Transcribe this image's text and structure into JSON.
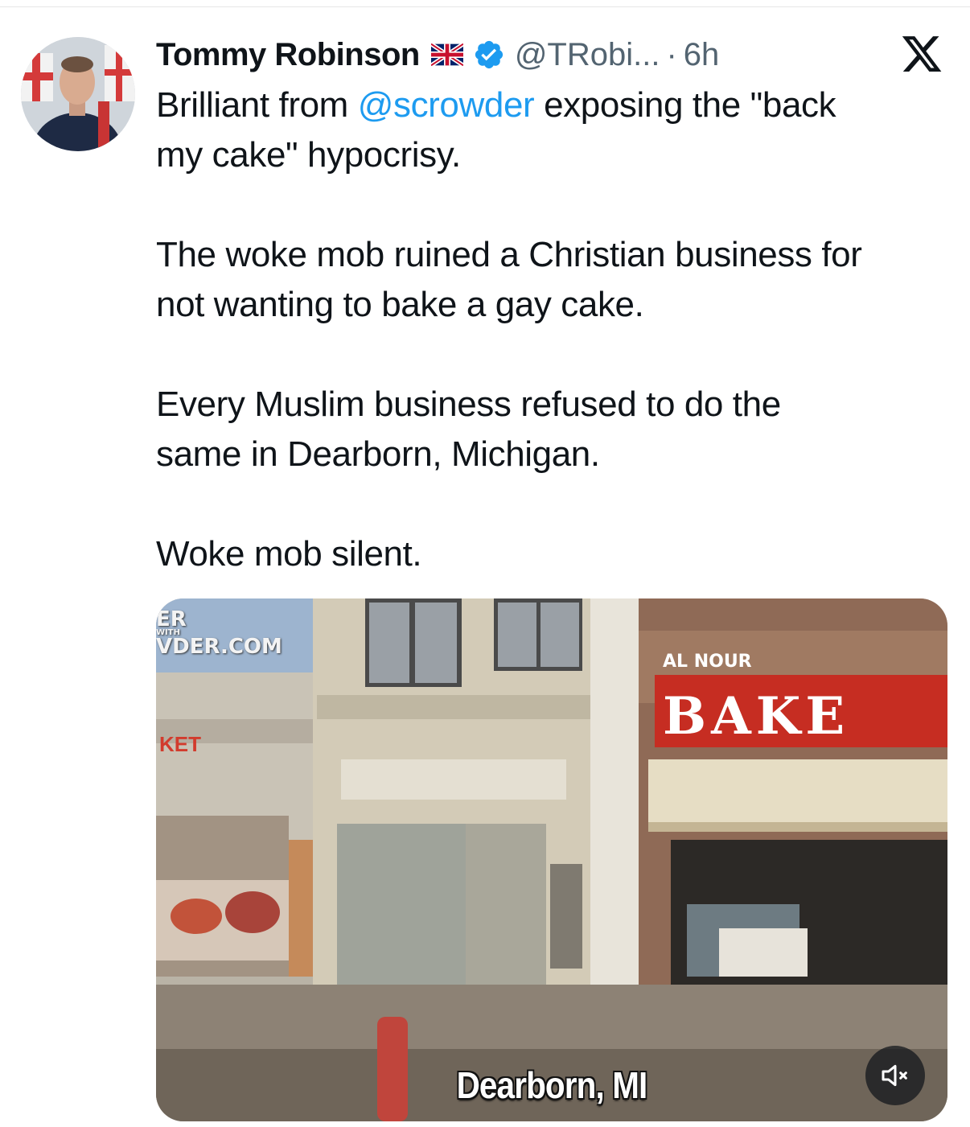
{
  "tweet": {
    "display_name": "Tommy Robinson",
    "handle": "@TRobi...",
    "separator": "·",
    "time": "6h",
    "text": {
      "line1_before": "Brilliant from ",
      "mention": "@scrowder",
      "line1_after": " exposing the \"back",
      "line2": "my cake\" hypocrisy.",
      "para2_line1": "The woke mob ruined a Christian business for",
      "para2_line2": "not wanting to bake a gay cake.",
      "para3_line1": "Every Muslim business refused to do the",
      "para3_line2": "same in Dearborn, Michigan.",
      "para4": "Woke mob silent."
    }
  },
  "icons": {
    "avatar": "avatar",
    "flag": "uk-flag-icon",
    "verified": "verified-badge-icon",
    "logo": "x-logo-icon",
    "mute": "speaker-muted-icon"
  },
  "media": {
    "caption": "Dearborn, MI",
    "watermark_line1": "ER",
    "watermark_small": "WITH",
    "watermark_line2": "VDER.COM",
    "sign_small": "AL NOUR",
    "sign_large": "BAKE",
    "sign_left": "KET"
  },
  "colors": {
    "text": "#0f1419",
    "secondary": "#536471",
    "link": "#1d9bf0",
    "verified": "#1d9bf0"
  }
}
